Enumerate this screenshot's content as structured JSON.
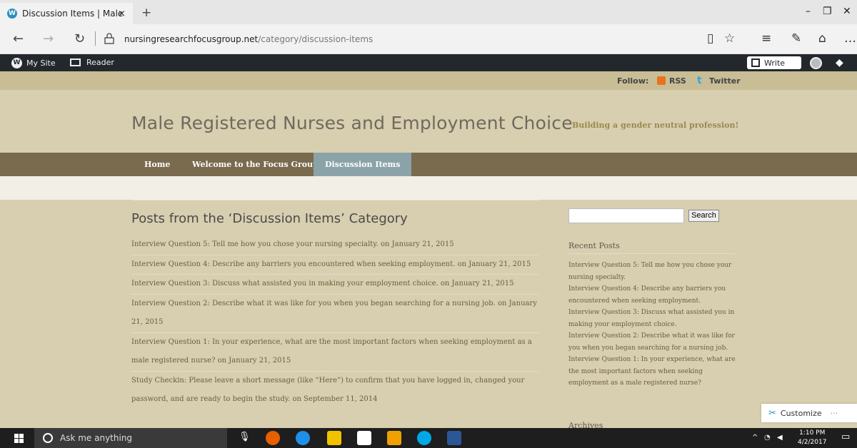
{
  "browser": {
    "tab_title": "Discussion Items | Male",
    "tab_close": "×",
    "new_tab": "+",
    "url_domain": "nursingresearchfocusgroup.net",
    "url_path": "/category/discussion-items"
  },
  "wpbar": {
    "my_site": "My Site",
    "reader": "Reader",
    "write": "Write"
  },
  "follow": {
    "label": "Follow:",
    "rss": "RSS",
    "twitter": "Twitter"
  },
  "site": {
    "title": "Male Registered Nurses and Employment Choice",
    "tagline": "Building a gender neutral profession!"
  },
  "nav": {
    "items": [
      "Home",
      "Welcome to the Focus Group!",
      "Discussion Items"
    ],
    "active_index": 2
  },
  "main": {
    "category_title": "Posts from the ‘Discussion Items’ Category",
    "posts": [
      {
        "title": "Interview Question 5: Tell me how you chose your nursing specialty.",
        "date": "on January 21, 2015"
      },
      {
        "title": "Interview Question 4: Describe any barriers you encountered when seeking employment.",
        "date": "on January 21, 2015"
      },
      {
        "title": "Interview Question 3: Discuss what assisted you in making your employment choice.",
        "date": "on January 21, 2015"
      },
      {
        "title": "Interview Question 2: Describe what it was like for you when you began searching for a nursing job.",
        "date": "on January 21, 2015"
      },
      {
        "title": "Interview Question 1: In your experience, what are the most important factors when seeking employment as a male registered nurse?",
        "date": "on January 21, 2015"
      },
      {
        "title": "Study Checkin: Please leave a short message (like “Here”) to confirm that you have logged in, changed your password, and are ready to begin the study.",
        "date": "on September 11, 2014"
      }
    ]
  },
  "sidebar": {
    "search_button": "Search",
    "recent_title": "Recent Posts",
    "recent": [
      "Interview Question 5: Tell me how you chose your nursing specialty.",
      "Interview Question 4: Describe any barriers you encountered when seeking employment.",
      "Interview Question 3: Discuss what assisted you in making your employment choice.",
      "Interview Question 2: Describe what it was like for you when you began searching for a nursing job.",
      "Interview Question 1: In your experience, what are the most important factors when seeking employment as a male registered nurse?"
    ],
    "archives_title": "Archives"
  },
  "customize": {
    "label": "Customize",
    "more": "···"
  },
  "taskbar": {
    "search_placeholder": "Ask me anything",
    "time": "1:10 PM",
    "date": "4/2/2017"
  },
  "colors": {
    "nav_bg": "#7a6a4e",
    "nav_active": "#8ba3a8",
    "page_bg": "#d8ceb0"
  }
}
